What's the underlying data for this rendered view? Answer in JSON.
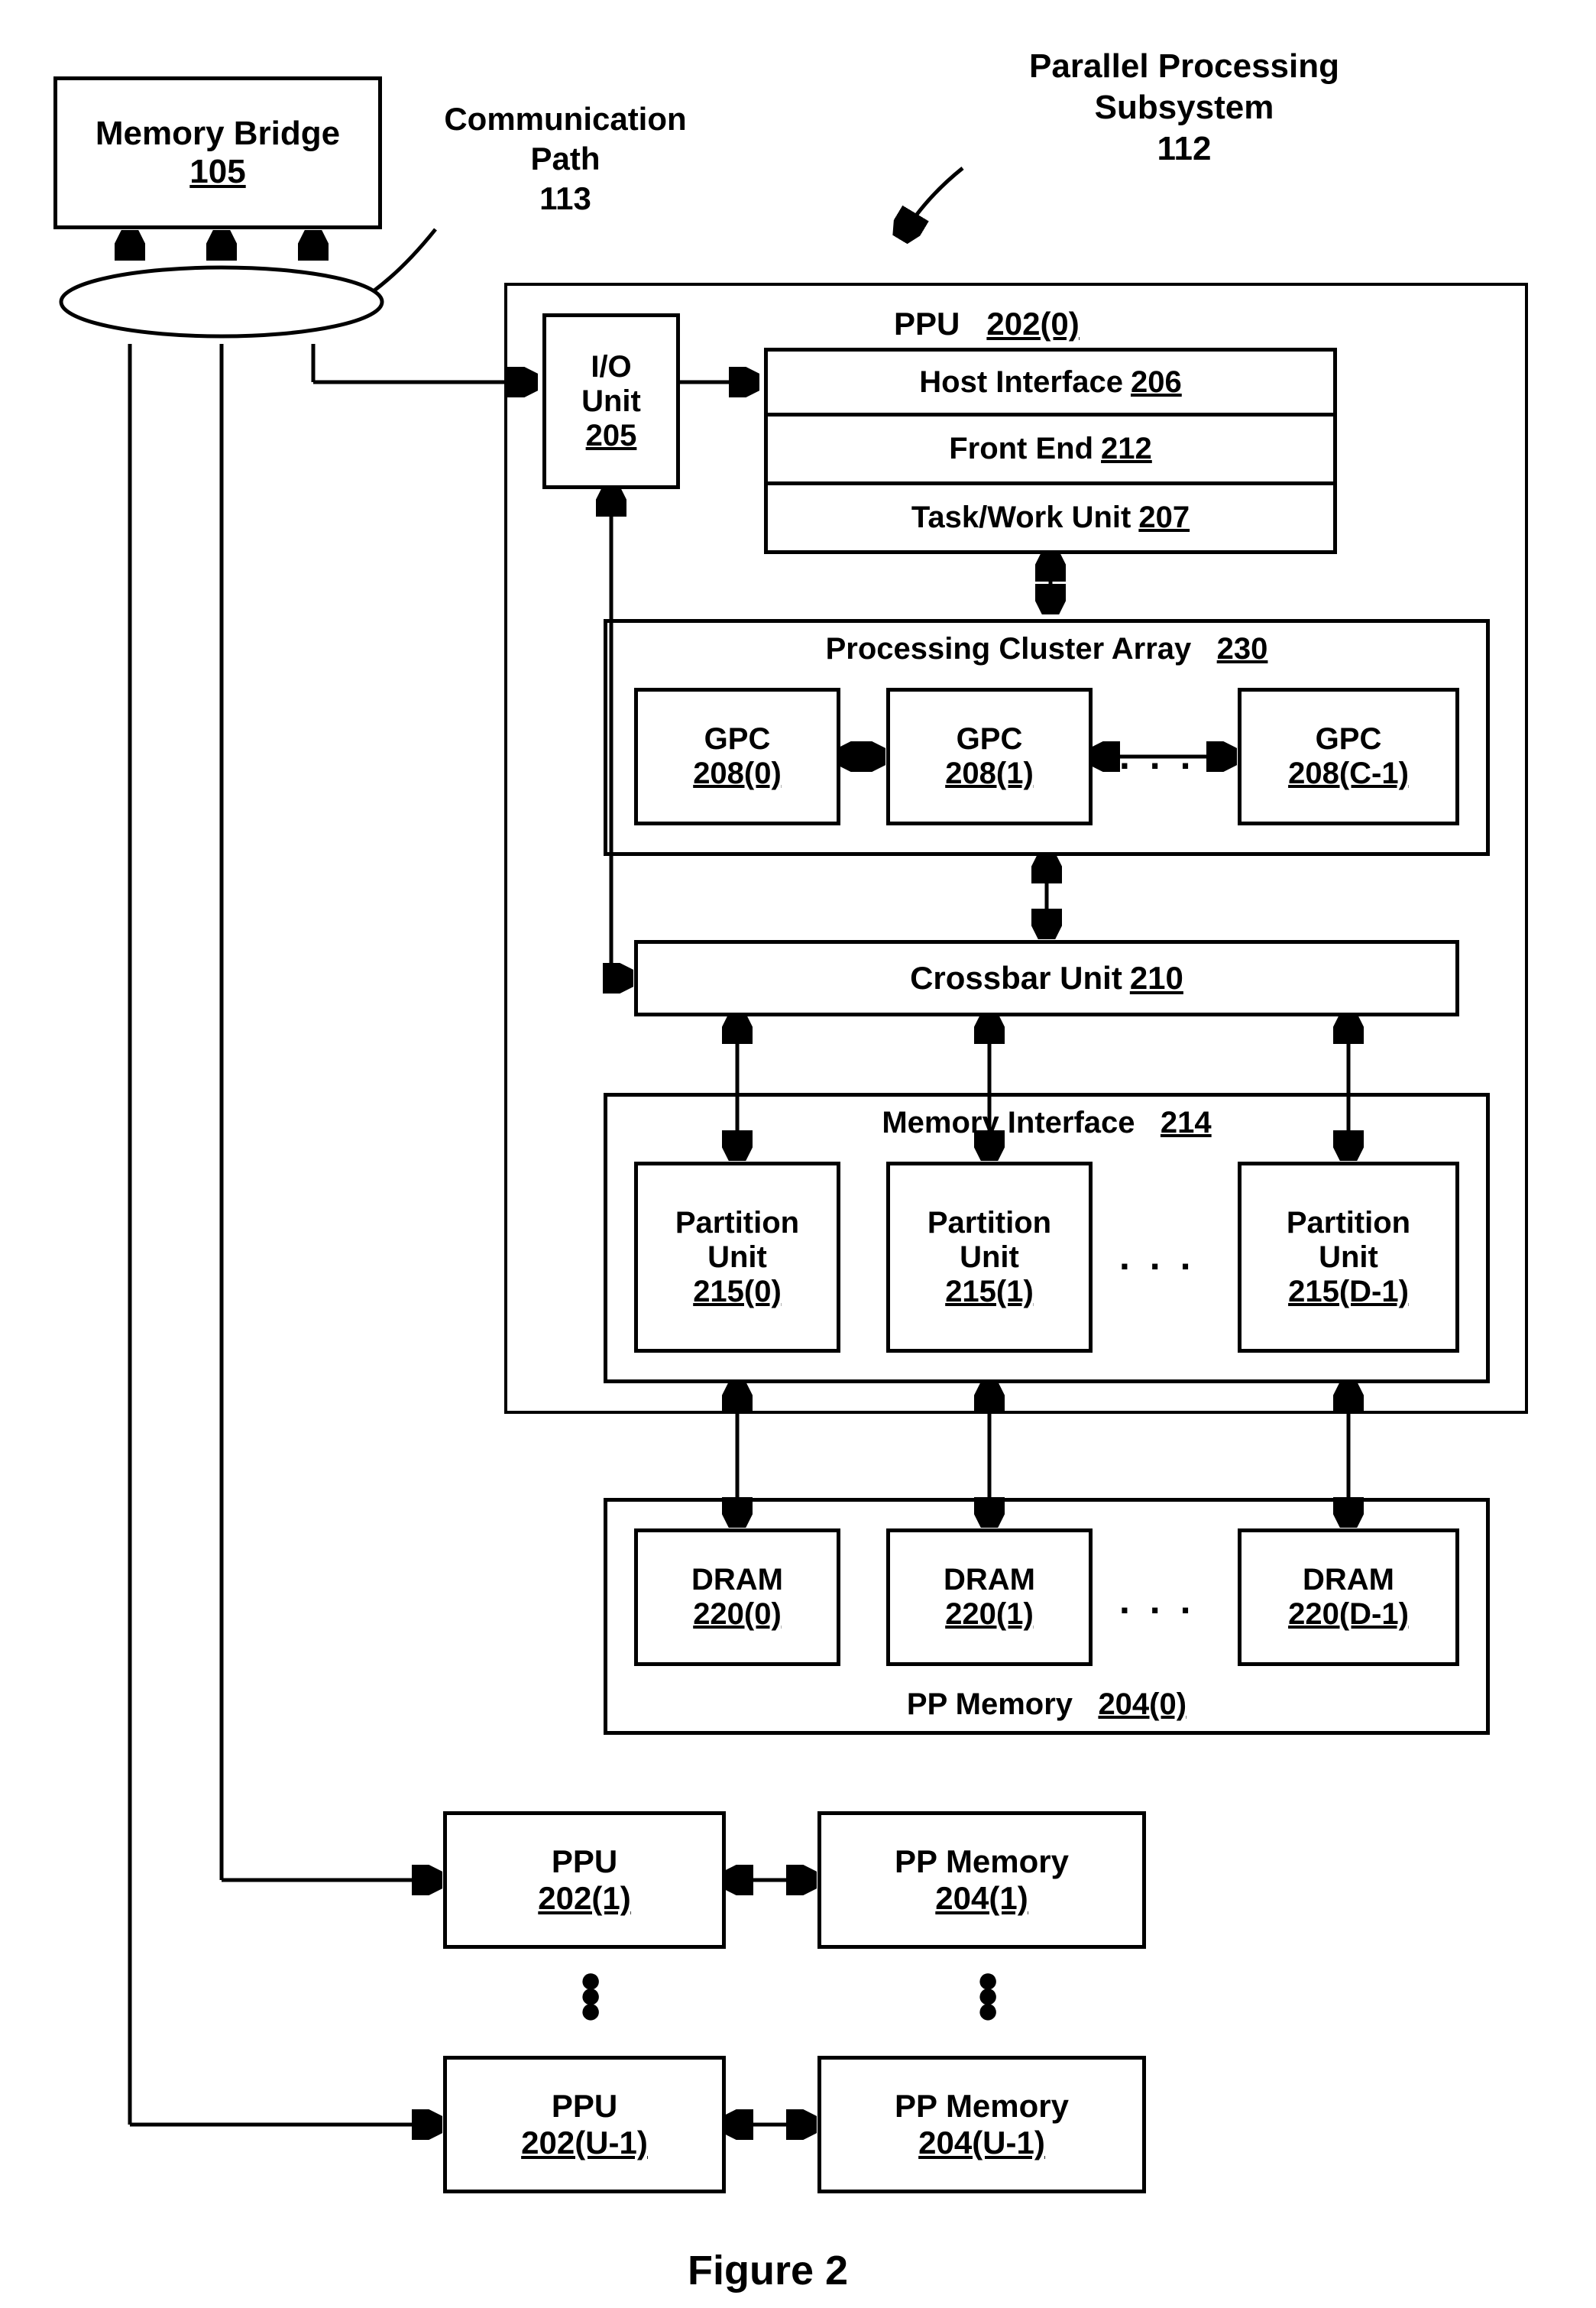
{
  "memoryBridge": {
    "title": "Memory Bridge",
    "ref": "105"
  },
  "commPath": {
    "title": "Communication",
    "title2": "Path",
    "ref": "113"
  },
  "subsystem": {
    "title": "Parallel Processing",
    "title2": "Subsystem",
    "ref": "112"
  },
  "ppu0": {
    "title": "PPU",
    "ref": "202(0)"
  },
  "ioUnit": {
    "title": "I/O",
    "title2": "Unit",
    "ref": "205"
  },
  "hostInterface": {
    "title": "Host Interface",
    "ref": "206"
  },
  "frontEnd": {
    "title": "Front End",
    "ref": "212"
  },
  "taskWork": {
    "title": "Task/Work Unit",
    "ref": "207"
  },
  "pca": {
    "title": "Processing Cluster Array",
    "ref": "230"
  },
  "gpc0": {
    "title": "GPC",
    "ref": "208(0)"
  },
  "gpc1": {
    "title": "GPC",
    "ref": "208(1)"
  },
  "gpcC": {
    "title": "GPC",
    "ref": "208(C-1)"
  },
  "crossbar": {
    "title": "Crossbar Unit",
    "ref": "210"
  },
  "memIf": {
    "title": "Memory Interface",
    "ref": "214"
  },
  "pu0": {
    "title": "Partition",
    "title2": "Unit",
    "ref": "215(0)"
  },
  "pu1": {
    "title": "Partition",
    "title2": "Unit",
    "ref": "215(1)"
  },
  "puD": {
    "title": "Partition",
    "title2": "Unit",
    "ref": "215(D-1)"
  },
  "dram0": {
    "title": "DRAM",
    "ref": "220(0)"
  },
  "dram1": {
    "title": "DRAM",
    "ref": "220(1)"
  },
  "dramD": {
    "title": "DRAM",
    "ref": "220(D-1)"
  },
  "ppMem0": {
    "title": "PP Memory",
    "ref": "204(0)"
  },
  "ppu1": {
    "title": "PPU",
    "ref": "202(1)"
  },
  "ppMem1": {
    "title": "PP Memory",
    "ref": "204(1)"
  },
  "ppuU": {
    "title": "PPU",
    "ref": "202(U-1)"
  },
  "ppMemU": {
    "title": "PP Memory",
    "ref": "204(U-1)"
  },
  "figCaption": "Figure 2"
}
